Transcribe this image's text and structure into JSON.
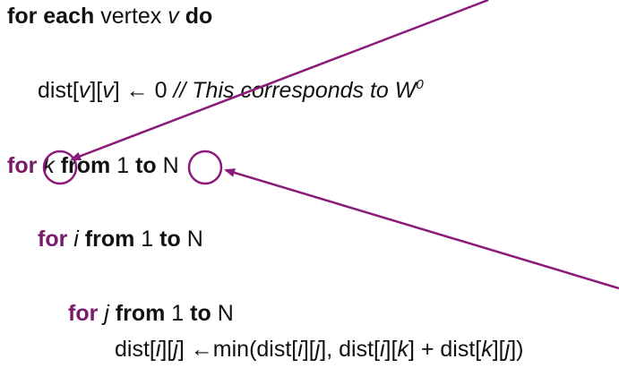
{
  "lines": {
    "line1": {
      "kw_for_each": "for each",
      "vertex_word": " vertex ",
      "v": "v",
      "kw_do": " do"
    },
    "line2": {
      "dist_open": "dist[",
      "v1": "v",
      "mid": "][",
      "v2": "v",
      "assign": "] ← 0 ",
      "comment": "// This corresponds to W",
      "sup": "0"
    },
    "line3": {
      "kw_for": "for",
      "k": "k",
      "kw_from": "from",
      "one": " 1 ",
      "kw_to": "to",
      "n": "N"
    },
    "line4": {
      "kw_for": "for",
      "i": "i",
      "kw_from": "from",
      "one": " 1 ",
      "kw_to": "to",
      "n": " N"
    },
    "line5": {
      "kw_for": "for",
      "j": "j",
      "kw_from": "from",
      "one": " 1 ",
      "kw_to": "to",
      "n": " N"
    },
    "line6": {
      "t1": "dist[",
      "i1": "i",
      "t2": "][",
      "j1": "j",
      "t3": "] ←min(dist[",
      "i2": "i",
      "t4": "][",
      "j2": "j",
      "t5": "], dist[",
      "i3": "i",
      "t6": "][",
      "k1": "k",
      "t7": "] + dist[",
      "k2": "k",
      "t8": "][",
      "j3": "j",
      "t9": "])"
    }
  },
  "colors": {
    "keyword_purple": "#7a1a6a",
    "annotation_purple": "#8b1a7a",
    "text": "#111111"
  }
}
